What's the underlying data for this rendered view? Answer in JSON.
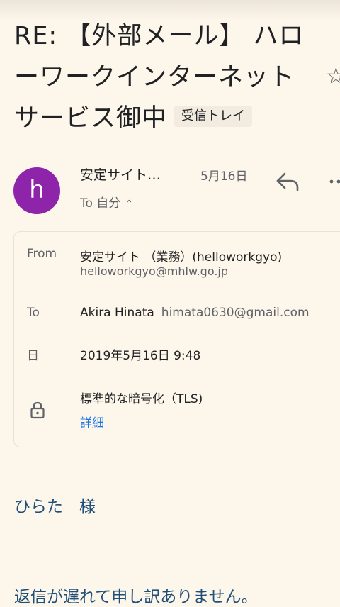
{
  "message": {
    "subject_lines": [
      "RE: 【外部メール】 ハロ",
      "ーワークインターネット",
      "サービス御中"
    ],
    "label_chip": "受信トレイ",
    "sender": {
      "avatar_letter": "h",
      "avatar_color": "#8e24aa",
      "name_truncated": "安定サイト…",
      "date": "5月16日",
      "recipient_toggle": "To 自分"
    },
    "details": {
      "from_label": "From",
      "from_name": "安定サイト （業務）(helloworkgyo)",
      "from_email": "helloworkgyo@mhlw.go.jp",
      "to_label": "To",
      "to_name": "Akira Hinata",
      "to_email": "himata0630@gmail.com",
      "date_label": "日",
      "date_value": "2019年5月16日 9:48",
      "security_text": "標準的な暗号化（TLS)",
      "security_link": "詳細"
    },
    "body_lines": [
      "ひらた　様",
      "返信が遅れて申し訳ありません。"
    ]
  },
  "icons": {
    "star": "star-icon",
    "reply": "reply-icon",
    "more": "more-vert-icon",
    "lock": "lock-icon",
    "chevron": "chevron-up-icon"
  },
  "colors": {
    "background": "#fdf6ea",
    "link": "#1a73e8",
    "body_text": "#1f4e79"
  }
}
